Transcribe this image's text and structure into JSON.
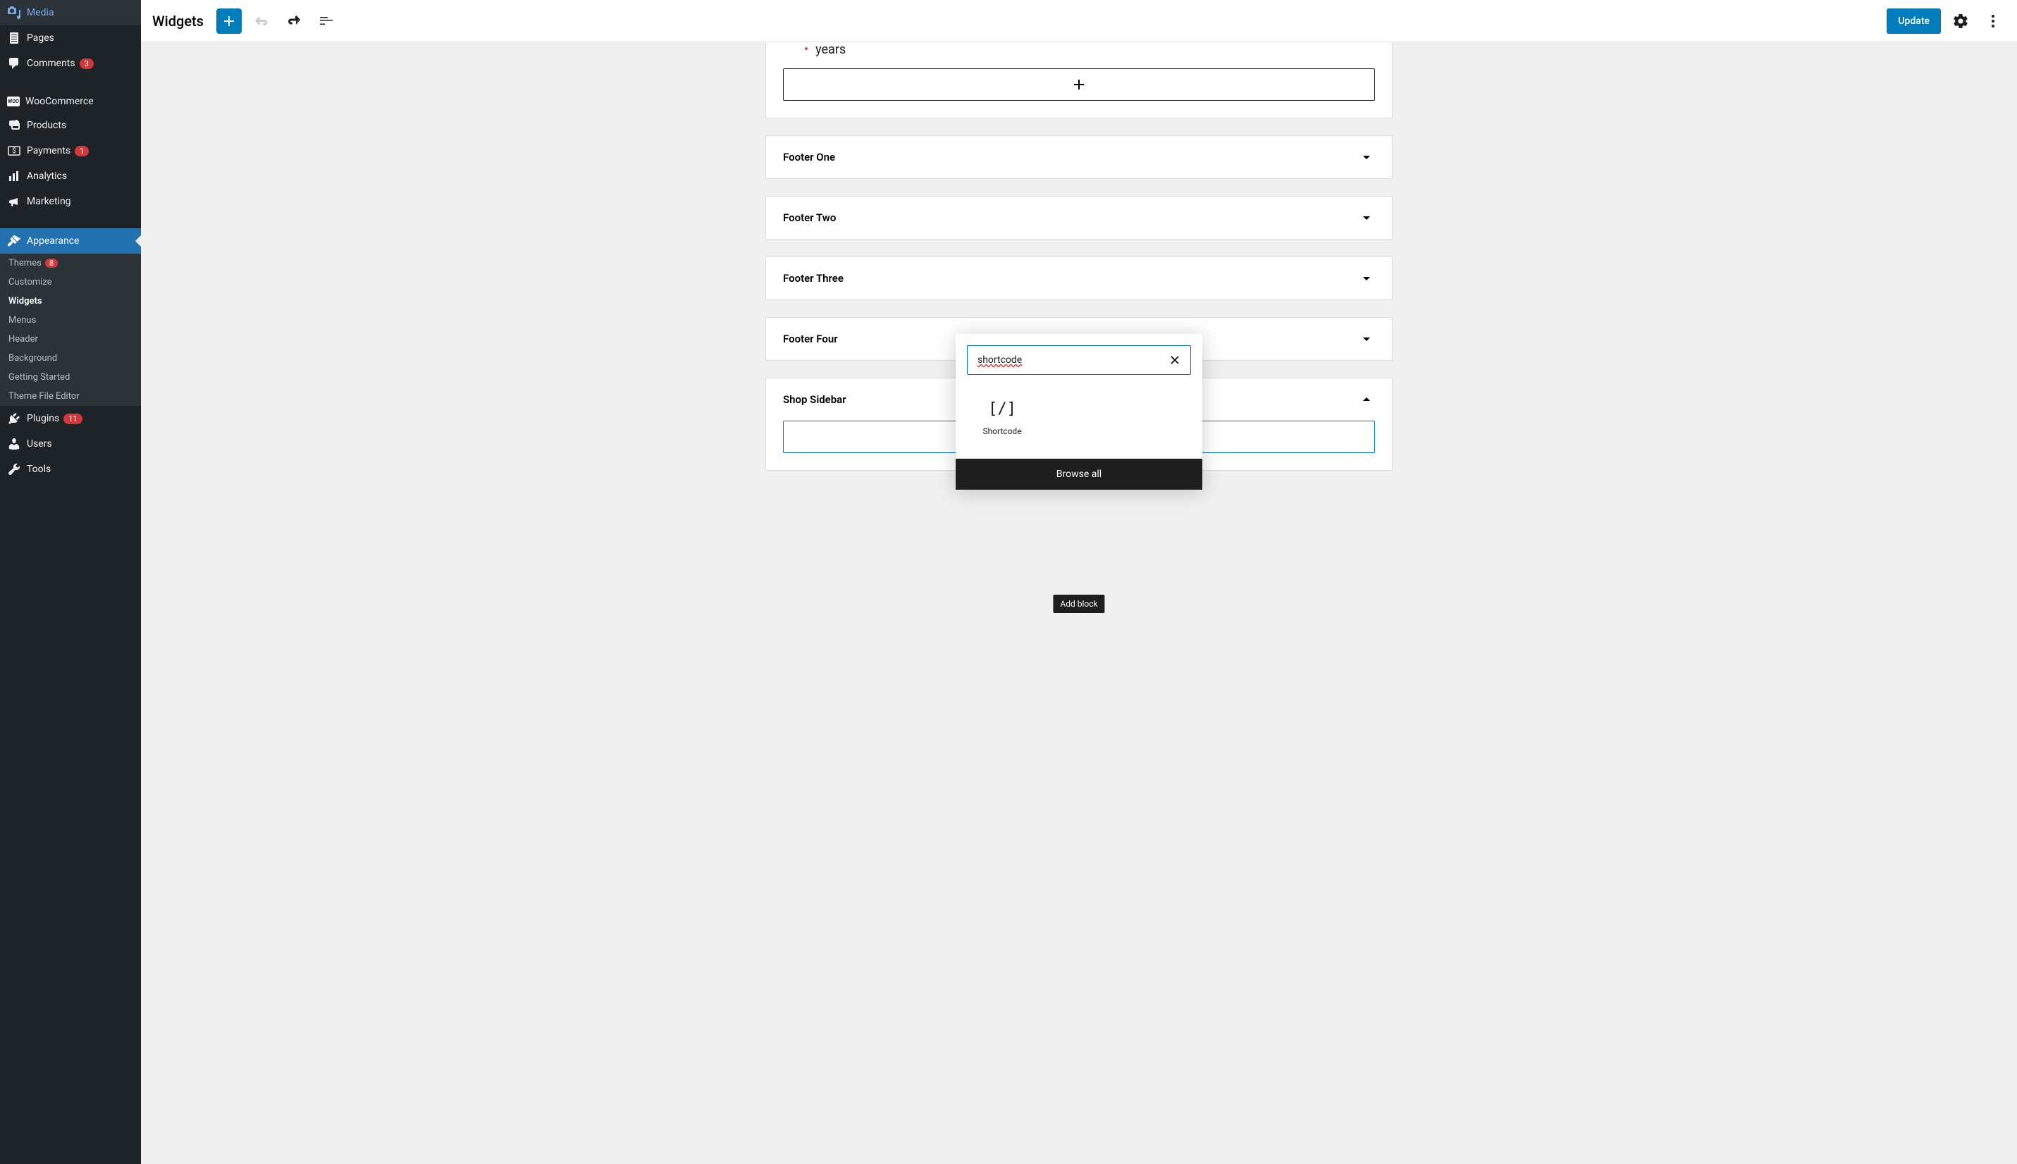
{
  "sidebar": {
    "items": [
      {
        "label": "Media",
        "icon": "media"
      },
      {
        "label": "Pages",
        "icon": "pages"
      },
      {
        "label": "Comments",
        "icon": "comments",
        "badge": "3"
      },
      {
        "label": "WooCommerce",
        "icon": "woo"
      },
      {
        "label": "Products",
        "icon": "products"
      },
      {
        "label": "Payments",
        "icon": "payments",
        "badge": "1"
      },
      {
        "label": "Analytics",
        "icon": "analytics"
      },
      {
        "label": "Marketing",
        "icon": "marketing"
      },
      {
        "label": "Appearance",
        "icon": "appearance",
        "active": true
      },
      {
        "label": "Plugins",
        "icon": "plugins",
        "badge": "11"
      },
      {
        "label": "Users",
        "icon": "users"
      },
      {
        "label": "Tools",
        "icon": "tools"
      }
    ],
    "subItems": [
      {
        "label": "Themes",
        "badge": "8"
      },
      {
        "label": "Customize"
      },
      {
        "label": "Widgets",
        "current": true
      },
      {
        "label": "Menus"
      },
      {
        "label": "Header"
      },
      {
        "label": "Background"
      },
      {
        "label": "Getting Started"
      },
      {
        "label": "Theme File Editor"
      }
    ]
  },
  "topbar": {
    "title": "Widgets",
    "updateLabel": "Update"
  },
  "content": {
    "leftoverText": "years",
    "areas": [
      {
        "title": "Footer One",
        "expanded": false
      },
      {
        "title": "Footer Two",
        "expanded": false
      },
      {
        "title": "Footer Three",
        "expanded": false
      },
      {
        "title": "Footer Four",
        "expanded": false
      },
      {
        "title": "Shop Sidebar",
        "expanded": true
      }
    ]
  },
  "popover": {
    "searchValue": "shortcode",
    "results": [
      {
        "label": "Shortcode",
        "iconText": "[/]"
      }
    ],
    "browseAll": "Browse all"
  },
  "tooltip": "Add block"
}
